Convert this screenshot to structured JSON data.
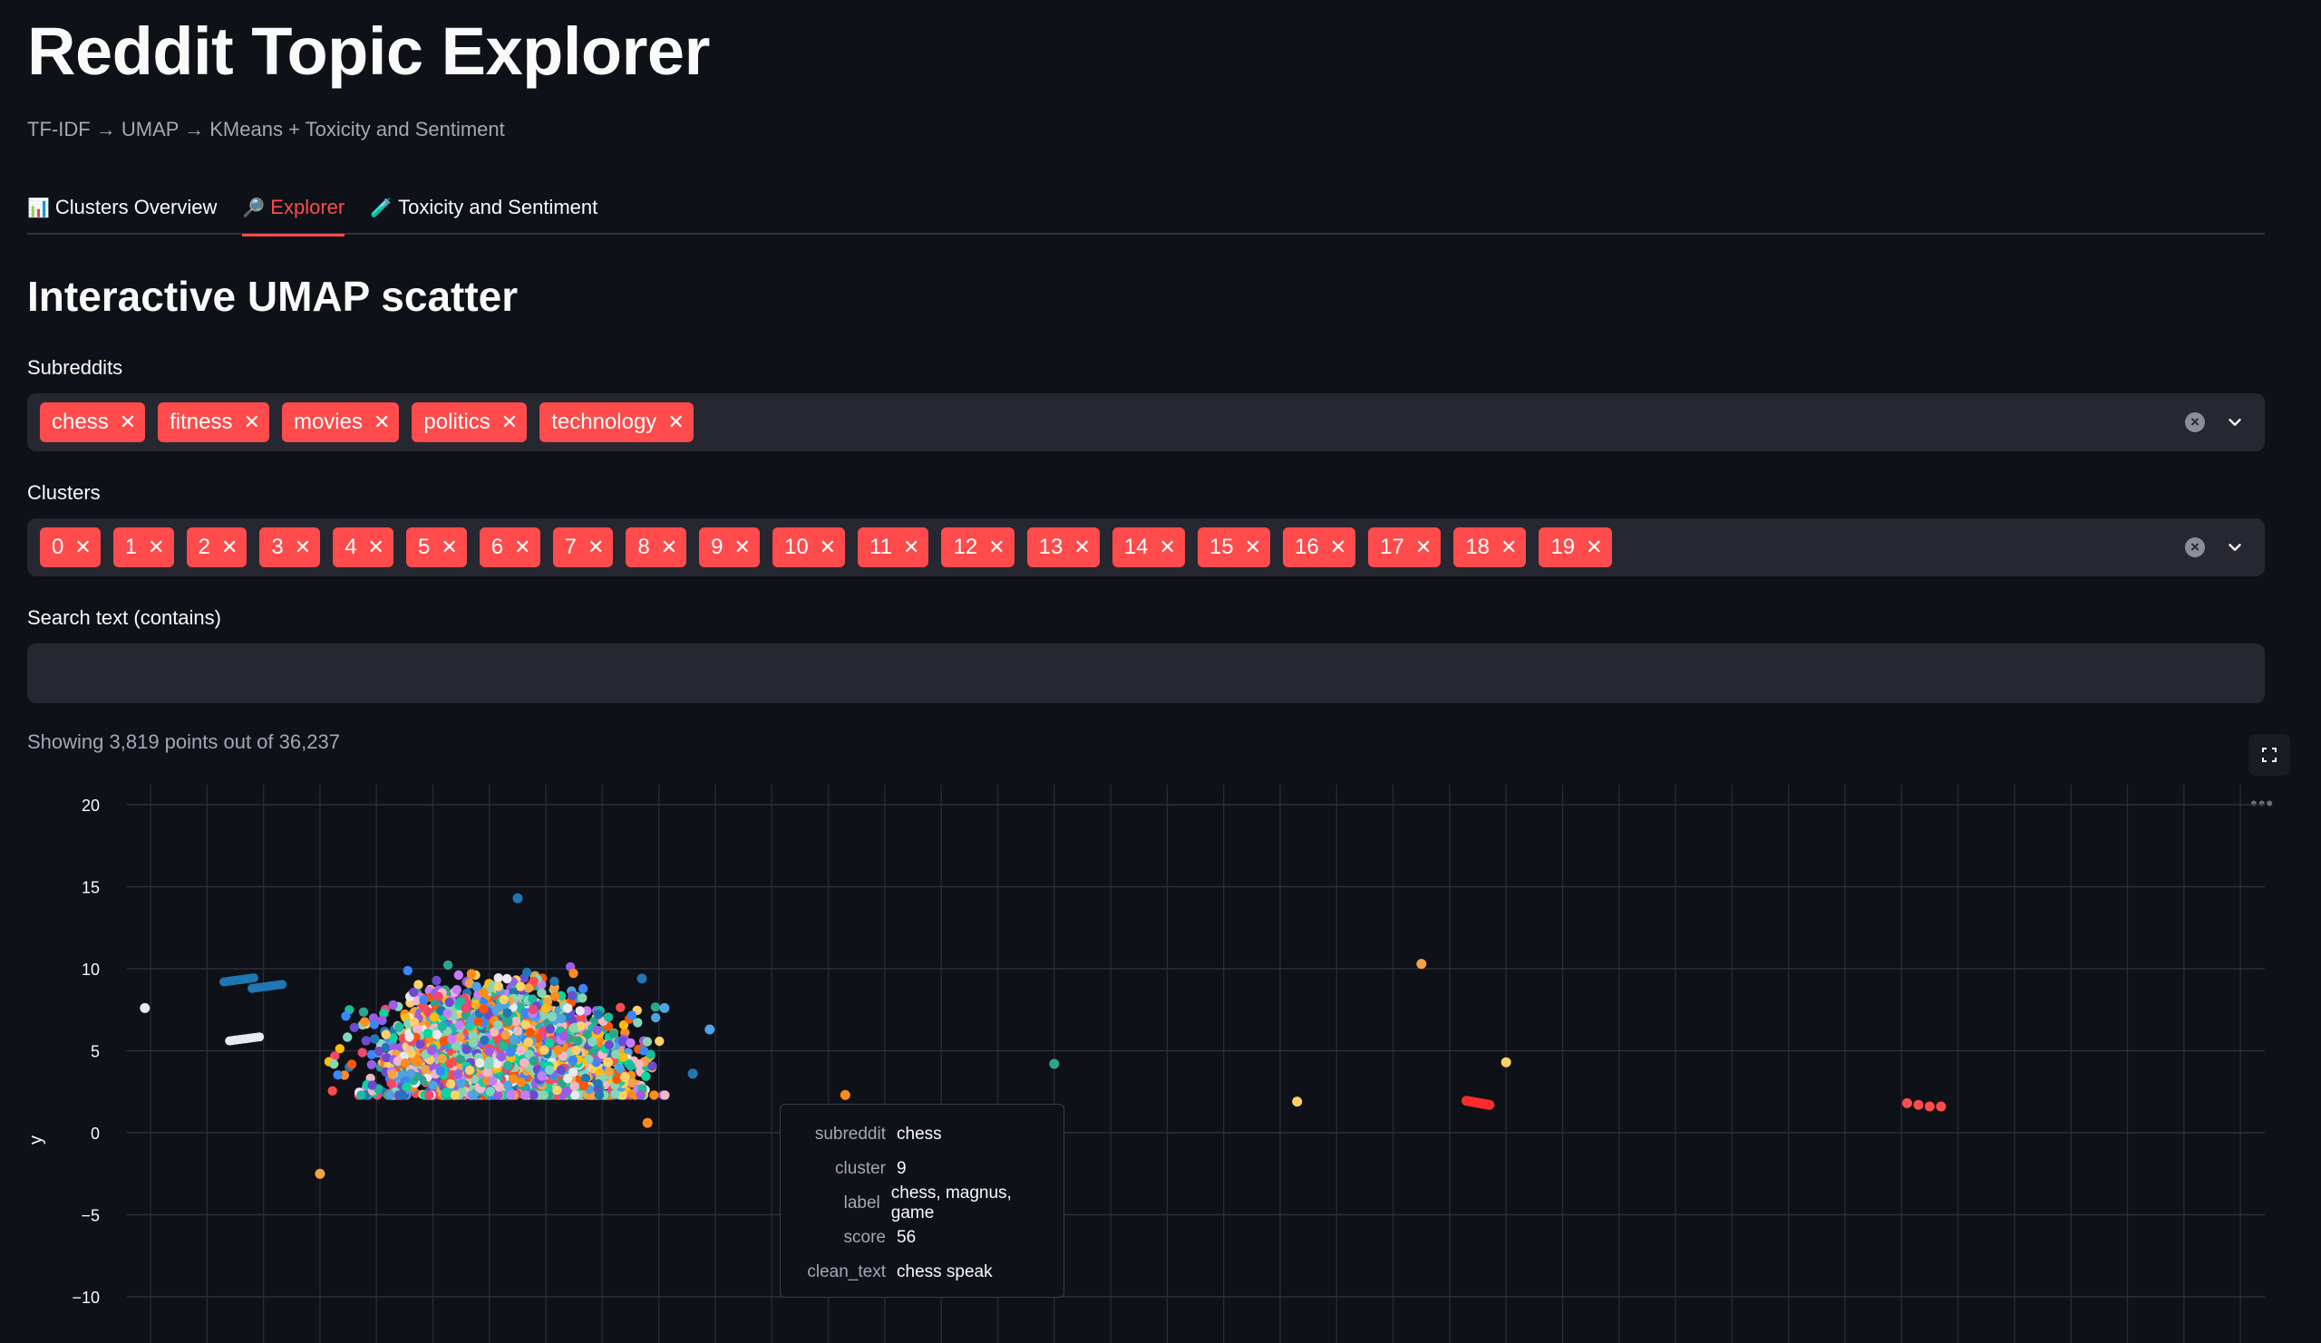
{
  "app": {
    "title": "Reddit Topic Explorer",
    "subtitle": "TF-IDF → UMAP → KMeans + Toxicity and Sentiment"
  },
  "tabs": [
    {
      "icon": "📊",
      "label": "Clusters Overview",
      "active": false
    },
    {
      "icon": "🔎",
      "label": "Explorer",
      "active": true
    },
    {
      "icon": "🧪",
      "label": "Toxicity and Sentiment",
      "active": false
    }
  ],
  "section": {
    "heading": "Interactive UMAP scatter"
  },
  "subreddits": {
    "label": "Subreddits",
    "selected": [
      "chess",
      "fitness",
      "movies",
      "politics",
      "technology"
    ]
  },
  "clusters": {
    "label": "Clusters",
    "selected": [
      "0",
      "1",
      "2",
      "3",
      "4",
      "5",
      "6",
      "7",
      "8",
      "9",
      "10",
      "11",
      "12",
      "13",
      "14",
      "15",
      "16",
      "17",
      "18",
      "19"
    ]
  },
  "search": {
    "label": "Search text (contains)",
    "value": "",
    "placeholder": ""
  },
  "status": {
    "count_text": "Showing 3,819 points out of 36,237"
  },
  "tooltip": {
    "rows": [
      {
        "key": "subreddit",
        "value": "chess"
      },
      {
        "key": "cluster",
        "value": "9"
      },
      {
        "key": "label",
        "value": "chess, magnus, game"
      },
      {
        "key": "score",
        "value": "56"
      },
      {
        "key": "clean_text",
        "value": "chess speak"
      }
    ]
  },
  "colors": {
    "accent": "#ff4b4b",
    "background": "#0e1117",
    "widget_bg": "#262730",
    "palette": [
      "#1f77b4",
      "#4fa3e0",
      "#2ca58d",
      "#1abc9c",
      "#8ad4b0",
      "#f4a340",
      "#ff8c1a",
      "#ffd166",
      "#ef476f",
      "#ff4b4b",
      "#9b5de5",
      "#6a4ccf",
      "#c77dff",
      "#f5b7c5",
      "#e9e9ef",
      "#7fd8be",
      "#3a86ff",
      "#ffbe0b",
      "#06d6a0",
      "#fb5607"
    ]
  },
  "chart_data": {
    "type": "scatter",
    "ylabel": "y",
    "ylim": [
      -12,
      21
    ],
    "y_ticks": [
      20,
      15,
      10,
      5,
      0,
      -5,
      -10
    ],
    "grid": true,
    "points": [
      {
        "x": -1.6,
        "y": 7.6,
        "c": 14
      },
      {
        "x": 6.6,
        "y": 4.3,
        "c": 7
      },
      {
        "x": 7.3,
        "y": 0.6,
        "c": 6
      },
      {
        "x": 10.8,
        "y": 2.3,
        "c": 6
      },
      {
        "x": 8.1,
        "y": 3.6,
        "c": 0
      },
      {
        "x": 6.9,
        "y": 3.4,
        "c": 7
      },
      {
        "x": 14.5,
        "y": 4.2,
        "c": 2
      },
      {
        "x": 21.0,
        "y": 10.3,
        "c": 5
      },
      {
        "x": 18.8,
        "y": 1.9,
        "c": 7
      },
      {
        "x": 22.5,
        "y": 4.3,
        "c": 7
      },
      {
        "x": 29.6,
        "y": 1.8,
        "c": 9
      },
      {
        "x": 29.8,
        "y": 1.7,
        "c": 9
      },
      {
        "x": 30.0,
        "y": 1.6,
        "c": 9
      },
      {
        "x": 30.2,
        "y": 1.6,
        "c": 9
      },
      {
        "x": 1.5,
        "y": -2.5,
        "c": 5
      },
      {
        "x": 5.0,
        "y": 14.3,
        "c": 0
      },
      {
        "x": 8.4,
        "y": 6.3,
        "c": 1
      },
      {
        "x": 7.6,
        "y": 7.6,
        "c": 1
      },
      {
        "x": 7.2,
        "y": 9.4,
        "c": 0
      }
    ],
    "main_cluster": {
      "x_range": [
        1.5,
        8.0
      ],
      "y_range": [
        2.5,
        12.5
      ],
      "n_points": 3800
    }
  }
}
